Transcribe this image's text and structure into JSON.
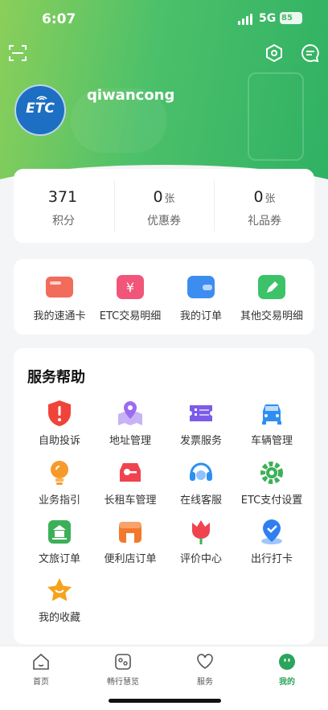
{
  "status_bar": {
    "time": "6:07",
    "network": "5G",
    "battery": "85"
  },
  "header": {
    "scan_icon": "scan-icon",
    "settings_icon": "hexagon-settings-icon",
    "message_icon": "chat-bubble-icon",
    "avatar_logo": "ETC",
    "username": "qiwancong"
  },
  "stats": [
    {
      "value": "371",
      "unit": "",
      "label": "积分"
    },
    {
      "value": "0",
      "unit": "张",
      "label": "优惠券"
    },
    {
      "value": "0",
      "unit": "张",
      "label": "礼品券"
    }
  ],
  "quick_actions": [
    {
      "label": "我的速通卡",
      "icon": "card-icon",
      "color": "#f26b5b"
    },
    {
      "label": "ETC交易明细",
      "icon": "yen-ticket-icon",
      "color": "#f2557a"
    },
    {
      "label": "我的订单",
      "icon": "wallet-icon",
      "color": "#3d8df0"
    },
    {
      "label": "其他交易明细",
      "icon": "pencil-note-icon",
      "color": "#3cc36a"
    }
  ],
  "services": {
    "title": "服务帮助",
    "items": [
      {
        "label": "自助投诉",
        "icon": "shield-alert-icon",
        "color": "#f0433a"
      },
      {
        "label": "地址管理",
        "icon": "location-map-icon",
        "color": "#9b6cf0"
      },
      {
        "label": "发票服务",
        "icon": "invoice-ticket-icon",
        "color": "#7b5ce8"
      },
      {
        "label": "车辆管理",
        "icon": "car-icon",
        "color": "#2f8ff0"
      },
      {
        "label": "业务指引",
        "icon": "lightbulb-icon",
        "color": "#f79a2c"
      },
      {
        "label": "长租车管理",
        "icon": "rental-car-key-icon",
        "color": "#f0434f"
      },
      {
        "label": "在线客服",
        "icon": "headset-icon",
        "color": "#2f8ff0"
      },
      {
        "label": "ETC支付设置",
        "icon": "gear-wrench-icon",
        "color": "#3cb058"
      },
      {
        "label": "文旅订单",
        "icon": "temple-ticket-icon",
        "color": "#3cb058"
      },
      {
        "label": "便利店订单",
        "icon": "store-icon",
        "color": "#f2792c"
      },
      {
        "label": "评价中心",
        "icon": "tulip-icon",
        "color": "#f0434f"
      },
      {
        "label": "出行打卡",
        "icon": "location-check-icon",
        "color": "#2f7ff0"
      },
      {
        "label": "我的收藏",
        "icon": "star-icon",
        "color": "#f5a21c"
      }
    ]
  },
  "tabbar": [
    {
      "label": "首页",
      "icon": "home-icon",
      "active": false
    },
    {
      "label": "畅行慧览",
      "icon": "browse-icon",
      "active": false
    },
    {
      "label": "服务",
      "icon": "heart-icon",
      "active": false
    },
    {
      "label": "我的",
      "icon": "profile-icon",
      "active": true
    }
  ]
}
